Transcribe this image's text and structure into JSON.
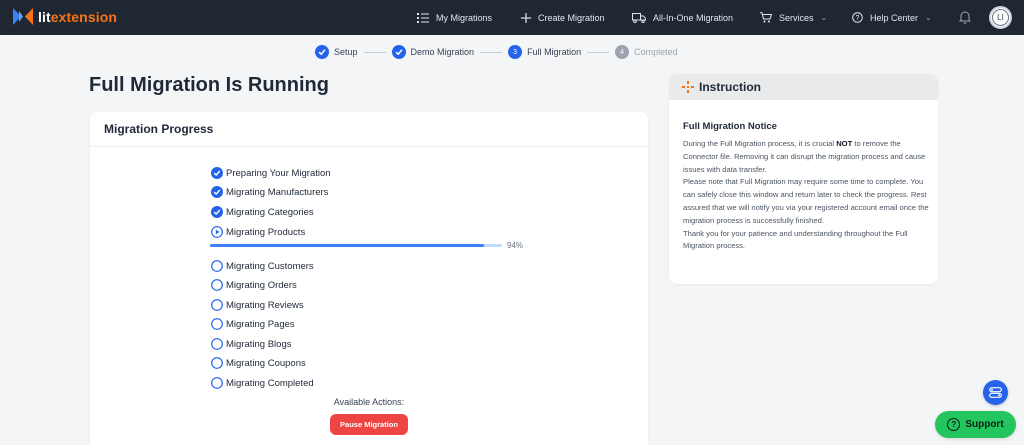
{
  "brand": {
    "prefix": "lit",
    "suffix": "extension"
  },
  "nav": {
    "my_migrations": "My Migrations",
    "create_migration": "Create Migration",
    "all_in_one": "All-In-One Migration",
    "services": "Services",
    "help_center": "Help Center",
    "avatar_initial": "LI"
  },
  "stepper": {
    "steps": [
      {
        "label": "Setup",
        "state": "done"
      },
      {
        "label": "Demo Migration",
        "state": "done"
      },
      {
        "label": "Full Migration",
        "number": "3",
        "state": "current"
      },
      {
        "label": "Completed",
        "number": "4",
        "state": "pending"
      }
    ]
  },
  "page": {
    "title": "Full Migration Is Running"
  },
  "progress_card": {
    "title": "Migration Progress",
    "tasks": [
      {
        "label": "Preparing Your Migration",
        "status": "done"
      },
      {
        "label": "Migrating Manufacturers",
        "status": "done"
      },
      {
        "label": "Migrating Categories",
        "status": "done"
      },
      {
        "label": "Migrating Products",
        "status": "running"
      },
      {
        "label": "Migrating Customers",
        "status": "pending"
      },
      {
        "label": "Migrating Orders",
        "status": "pending"
      },
      {
        "label": "Migrating Reviews",
        "status": "pending"
      },
      {
        "label": "Migrating Pages",
        "status": "pending"
      },
      {
        "label": "Migrating Blogs",
        "status": "pending"
      },
      {
        "label": "Migrating Coupons",
        "status": "pending"
      },
      {
        "label": "Migrating Completed",
        "status": "pending"
      }
    ],
    "products_progress_value": 94,
    "products_progress_text": "94%",
    "actions_label": "Available Actions:",
    "pause_label": "Pause Migration"
  },
  "instruction": {
    "header": "Instruction",
    "notice_title": "Full Migration Notice",
    "p1_a": "During the Full Migration process, it is crucial ",
    "p1_b": "NOT",
    "p1_c": " to remove the Connector file. Removing it can disrupt the migration process and cause issues with data transfer.",
    "p2": "Please note that Full Migration may require some time to complete. You can safely close this window and return later to check the progress. Rest assured that we will notify you via your registered account email once the migration process is successfully finished.",
    "p3": "Thank you for your patience and understanding throughout the Full Migration process."
  },
  "support": {
    "label": "Support"
  },
  "colors": {
    "accent": "#2563eb",
    "brand_orange": "#f97316",
    "danger": "#ef4444",
    "success": "#22c55e",
    "nav_bg": "#1f2733"
  }
}
